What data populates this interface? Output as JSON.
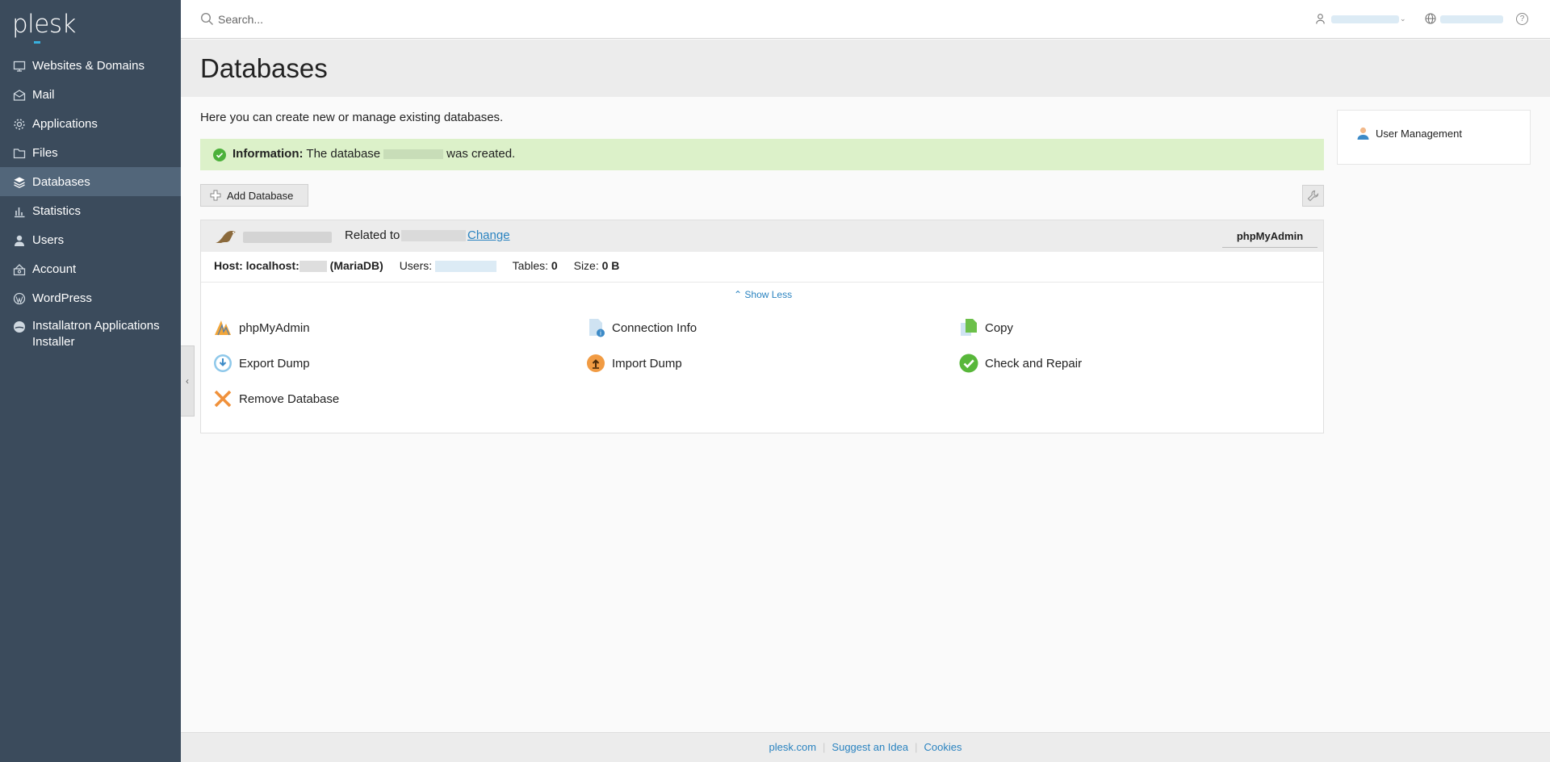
{
  "app": {
    "logo": "plesk"
  },
  "sidebar": {
    "items": [
      {
        "label": "Websites & Domains",
        "icon": "monitor-icon"
      },
      {
        "label": "Mail",
        "icon": "mail-icon"
      },
      {
        "label": "Applications",
        "icon": "gear-icon"
      },
      {
        "label": "Files",
        "icon": "folder-icon"
      },
      {
        "label": "Databases",
        "icon": "database-icon",
        "active": true
      },
      {
        "label": "Statistics",
        "icon": "bar-chart-icon"
      },
      {
        "label": "Users",
        "icon": "user-icon"
      },
      {
        "label": "Account",
        "icon": "account-icon"
      },
      {
        "label": "WordPress",
        "icon": "wordpress-icon"
      },
      {
        "label": "Installatron Applications Installer",
        "icon": "installatron-icon"
      }
    ],
    "collapse_glyph": "‹"
  },
  "topbar": {
    "search_placeholder": "Search...",
    "help_glyph": "?"
  },
  "page": {
    "title": "Databases",
    "intro": "Here you can create new or manage existing databases.",
    "info_label": "Information:",
    "info_text_before": "The database",
    "info_text_after": "was created.",
    "add_button": "Add Database"
  },
  "database": {
    "related_to": "Related to",
    "change": "Change",
    "phpmyadmin_button": "phpMyAdmin",
    "host_label": "Host: localhost:",
    "host_engine": "(MariaDB)",
    "users_label": "Users:",
    "tables_label": "Tables:",
    "tables_value": "0",
    "size_label": "Size:",
    "size_value": "0 B",
    "show_less": "Show Less",
    "actions": [
      {
        "label": "phpMyAdmin",
        "icon": "phpmyadmin-icon"
      },
      {
        "label": "Connection Info",
        "icon": "connection-info-icon"
      },
      {
        "label": "Copy",
        "icon": "copy-icon"
      },
      {
        "label": "Export Dump",
        "icon": "export-dump-icon"
      },
      {
        "label": "Import Dump",
        "icon": "import-dump-icon"
      },
      {
        "label": "Check and Repair",
        "icon": "check-repair-icon"
      },
      {
        "label": "Remove Database",
        "icon": "remove-icon"
      }
    ]
  },
  "side_panel": {
    "user_management": "User Management"
  },
  "footer": {
    "links": [
      "plesk.com",
      "Suggest an Idea",
      "Cookies"
    ]
  },
  "colors": {
    "sidebar": "#3b4b5c",
    "active": "#52667a",
    "link": "#2a83c0",
    "info_bg": "#dcf1c9"
  }
}
